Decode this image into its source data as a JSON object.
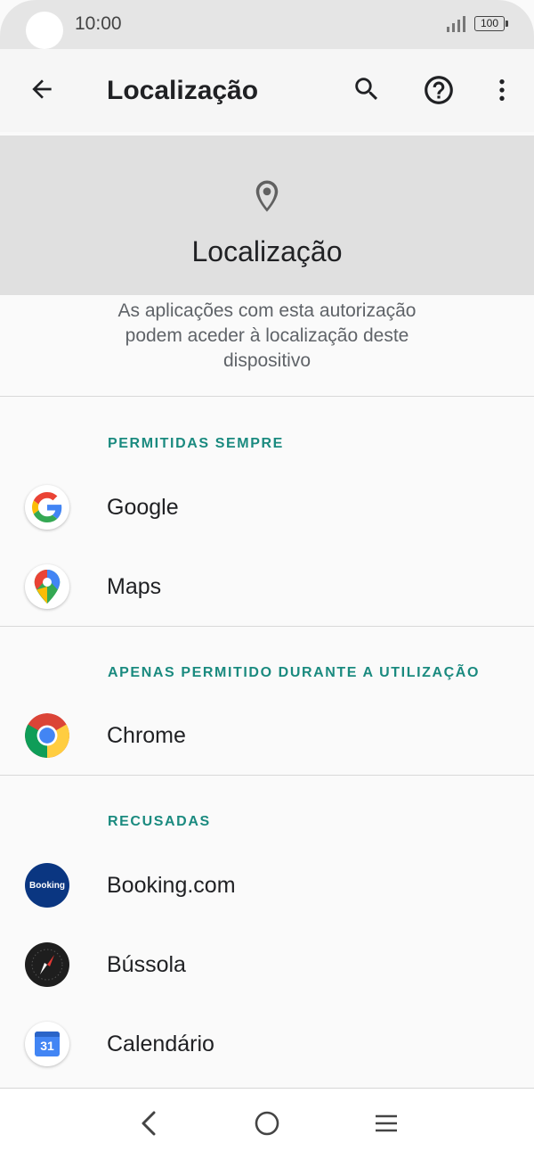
{
  "status_bar": {
    "time": "10:00",
    "battery": "100"
  },
  "app_bar": {
    "title": "Localização"
  },
  "hero": {
    "title": "Localização"
  },
  "description": {
    "lines": [
      "As aplicações com esta autorização",
      "podem aceder à localização deste",
      "dispositivo"
    ]
  },
  "sections": {
    "always": {
      "header": "PERMITIDAS SEMPRE",
      "apps": [
        "Google",
        "Maps"
      ]
    },
    "while_using": {
      "header": "APENAS PERMITIDO DURANTE A UTILIZAÇÃO",
      "apps": [
        "Chrome"
      ]
    },
    "denied": {
      "header": "RECUSADAS",
      "apps": [
        "Booking.com",
        "Bússola",
        "Calendário"
      ]
    }
  },
  "icons": {
    "booking_text": "Booking",
    "calendar_day": "31",
    "names": [
      "back-arrow-icon",
      "search-icon",
      "help-icon",
      "more-vert-icon",
      "location-pin-icon",
      "google-icon",
      "maps-icon",
      "chrome-icon",
      "booking-icon",
      "compass-icon",
      "calendar-icon"
    ]
  },
  "colors": {
    "accent": "#1a8a7f",
    "hero_bg": "#e0e0e0",
    "statusbar_bg": "#e5e5e5"
  }
}
